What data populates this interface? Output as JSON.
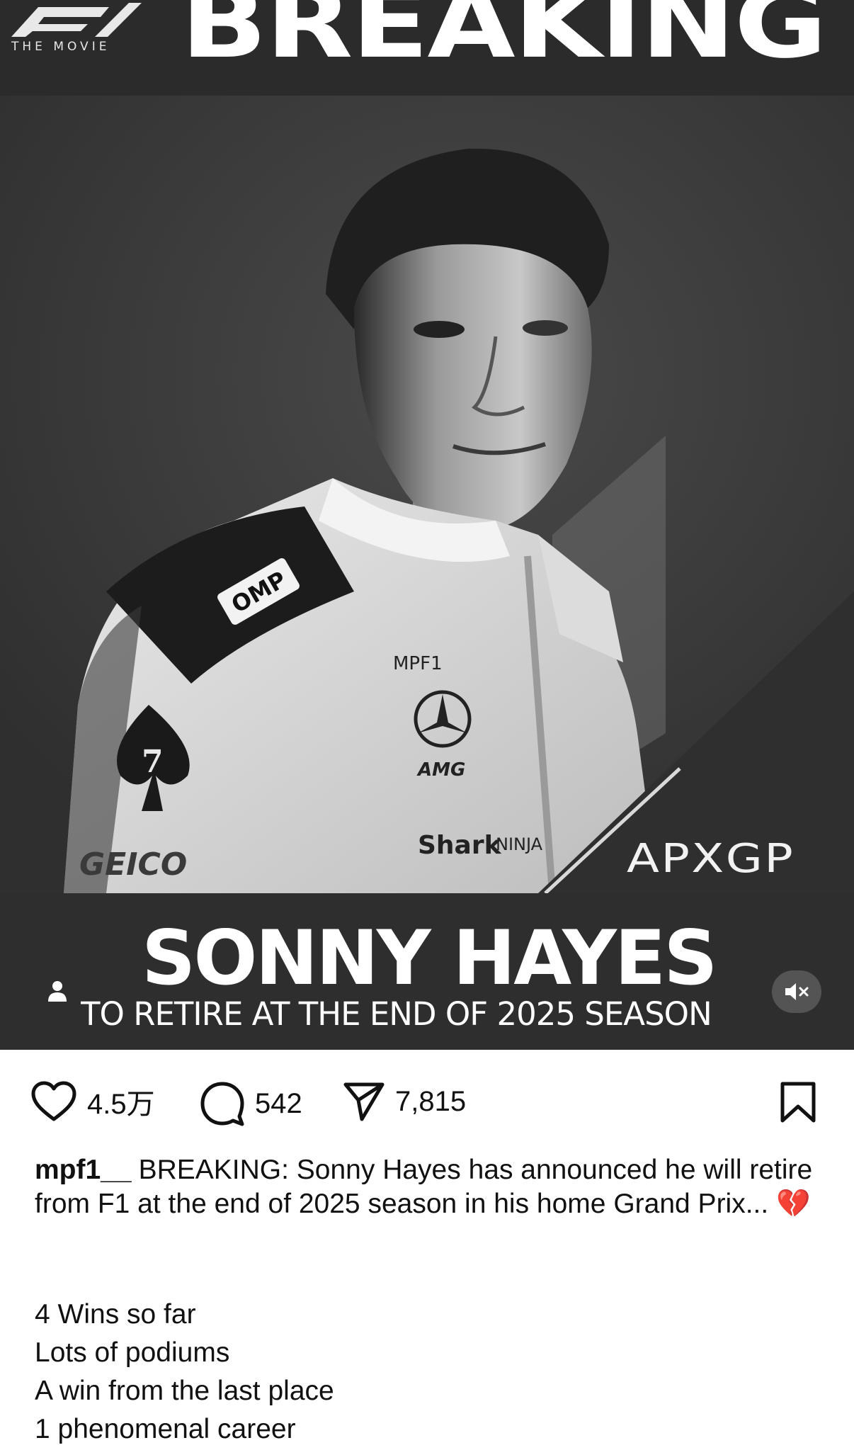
{
  "post": {
    "logo_subtext": "THE MOVIE",
    "headline": "BREAKING",
    "name": "SONNY HAYES",
    "subtitle": "TO RETIRE AT THE END OF 2025 SEASON",
    "team_logo": "APXGP",
    "suit_sponsors": [
      "OMP",
      "MPF1",
      "AMG",
      "Shark NINJA",
      "GEICO",
      "7"
    ]
  },
  "actions": {
    "likes": "4.5万",
    "comments": "542",
    "shares": "7,815",
    "icons": [
      "heart-icon",
      "comment-icon",
      "share-icon",
      "bookmark-icon"
    ]
  },
  "caption": {
    "username": "mpf1__",
    "text": "BREAKING: Sonny Hayes has announced he will retire from F1 at the end of 2025 season in his home Grand Prix...",
    "emoji": "💔",
    "lines": [
      "4 Wins so far",
      "Lots of podiums",
      "A win from the last place",
      "1 phenomenal career"
    ]
  },
  "colors": {
    "background": "#ffffff",
    "image_dark": "#2b2b2b",
    "text": "#111111"
  }
}
